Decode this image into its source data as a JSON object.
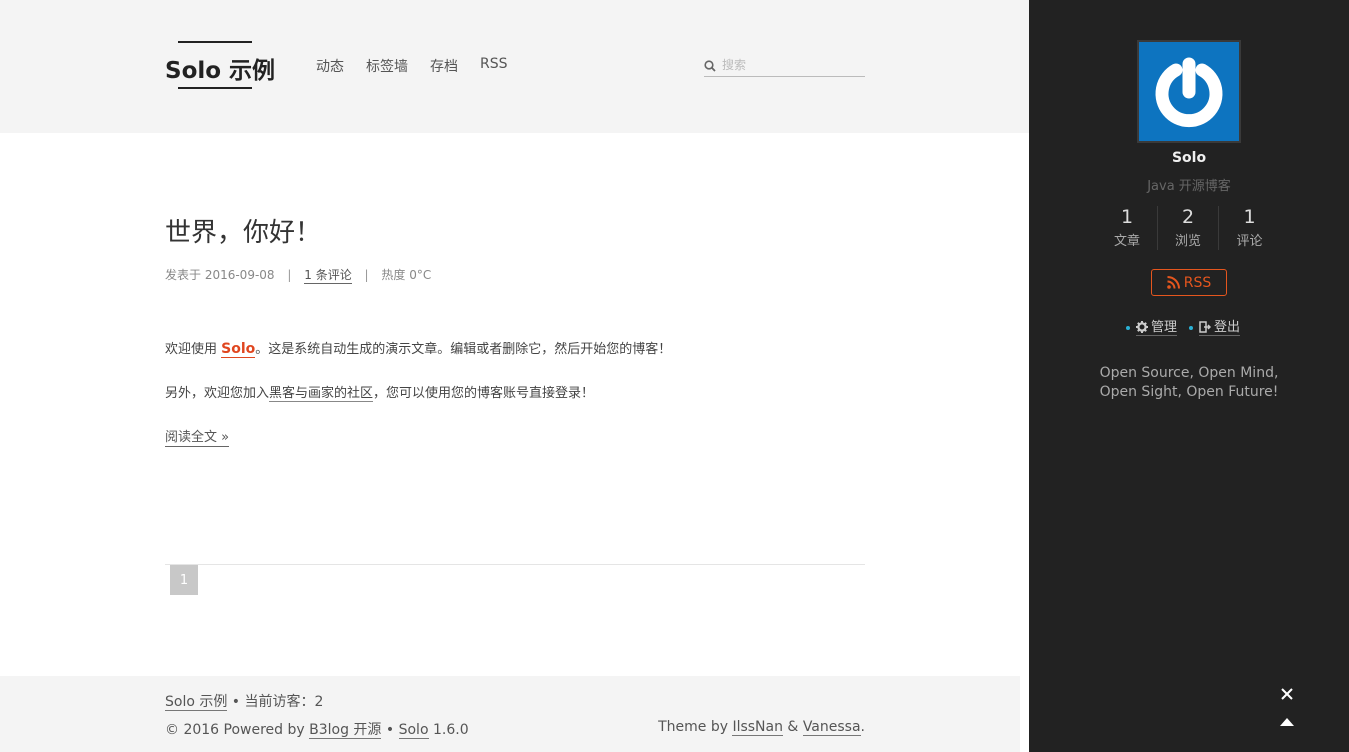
{
  "header": {
    "logo": "Solo 示例",
    "nav": [
      "动态",
      "标签墙",
      "存档",
      "RSS"
    ],
    "search": {
      "placeholder": "搜索",
      "value": ""
    }
  },
  "article": {
    "title": "世界，你好！",
    "meta": {
      "published": "发表于 2016-09-08",
      "sep": "|",
      "comments": "1 条评论",
      "heat": "热度 0°C"
    },
    "p1": {
      "before": "欢迎使用 ",
      "link": "Solo",
      "after": "。这是系统自动生成的演示文章。编辑或者删除它，然后开始您的博客！"
    },
    "p2": {
      "before": "另外，欢迎您加入",
      "link": "黑客与画家的社区",
      "after": "，您可以使用您的博客账号直接登录！"
    },
    "read_more": "阅读全文 »"
  },
  "pagination": {
    "current": "1"
  },
  "footer": {
    "site_link": "Solo 示例",
    "visitors": " • 当前访客：2",
    "copyright": "© 2016 Powered by ",
    "b3log": "B3log 开源",
    "bullet": " • ",
    "solo": "Solo",
    "version": " 1.6.0",
    "theme_prefix": "Theme by ",
    "author1": "IlssNan",
    "amp": " & ",
    "author2": "Vanessa",
    "period": "."
  },
  "sidebar": {
    "name": "Solo",
    "desc": "Java 开源博客",
    "stats": [
      {
        "num": "1",
        "label": "文章"
      },
      {
        "num": "2",
        "label": "浏览"
      },
      {
        "num": "1",
        "label": "评论"
      }
    ],
    "rss": "RSS",
    "admin": "管理",
    "logout": "登出",
    "motto_line1": "Open Source, Open Mind,",
    "motto_line2": "Open Sight, Open Future!"
  },
  "colors": {
    "accent": "#e5561e",
    "sidebar_bg": "#222222",
    "avatar_bg": "#0d74c0",
    "dot": "#2ab1d6"
  }
}
